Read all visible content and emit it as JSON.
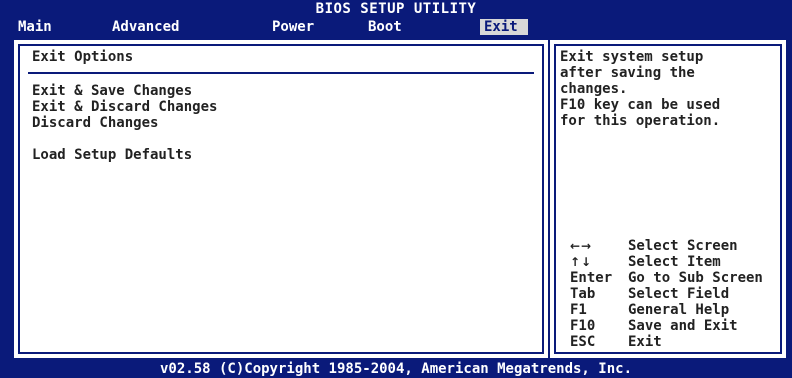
{
  "header": {
    "title": "BIOS SETUP UTILITY",
    "menu": [
      {
        "label": "Main",
        "selected": false
      },
      {
        "label": "Advanced",
        "selected": false
      },
      {
        "label": "Power",
        "selected": false
      },
      {
        "label": "Boot",
        "selected": false
      },
      {
        "label": "Exit",
        "selected": true
      }
    ]
  },
  "left_panel": {
    "section_title": "Exit Options",
    "options": [
      "Exit & Save Changes",
      "Exit & Discard Changes",
      "Discard Changes",
      "Load Setup Defaults"
    ]
  },
  "right_panel": {
    "help_text": "Exit system setup\nafter saving the\nchanges.\nF10 key can be used\nfor this operation.",
    "keys": [
      {
        "key_icon": "left-right-arrow-icon",
        "key": "←→",
        "action": "Select Screen"
      },
      {
        "key_icon": "up-down-arrow-icon",
        "key": "↑↓",
        "action": "Select Item"
      },
      {
        "key": "Enter",
        "action": "Go to Sub Screen"
      },
      {
        "key": "Tab",
        "action": "Select Field"
      },
      {
        "key": "F1",
        "action": "General Help"
      },
      {
        "key": "F10",
        "action": "Save and Exit"
      },
      {
        "key": "ESC",
        "action": "Exit"
      }
    ]
  },
  "footer": {
    "copyright": "v02.58 (C)Copyright 1985-2004, American Megatrends, Inc."
  },
  "colors": {
    "background_blue": "#0a1a7a",
    "panel_white": "#ffffff",
    "selected_tab_bg": "#d8d8d8"
  }
}
